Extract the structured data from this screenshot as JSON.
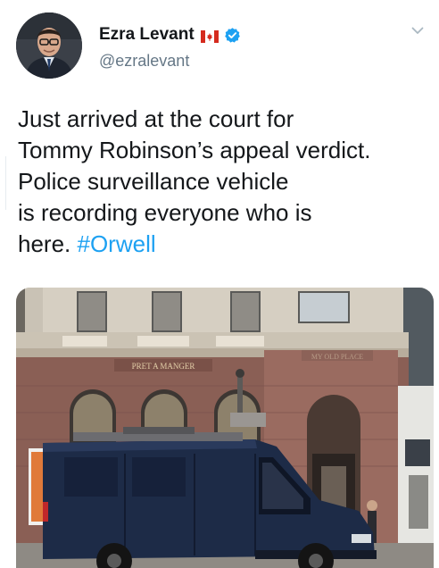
{
  "author": {
    "display_name": "Ezra Levant",
    "handle": "@ezralevant",
    "flag_icon": "canada-flag-icon",
    "verified_icon": "verified-badge-icon",
    "verified_color": "#1da1f2"
  },
  "tweet": {
    "text_lines": [
      "Just arrived at the court for",
      "Tommy Robinson’s appeal verdict.",
      "Police surveillance vehicle",
      "is recording everyone who is",
      "here."
    ],
    "hashtag": "#Orwell"
  },
  "menu": {
    "icon": "chevron-down-icon"
  },
  "media": {
    "shop_sign": "PRET A MANGER",
    "building_sign": "MY OLD PLACE"
  },
  "colors": {
    "link": "#1da1f2",
    "text": "#14171a",
    "secondary": "#657786"
  }
}
